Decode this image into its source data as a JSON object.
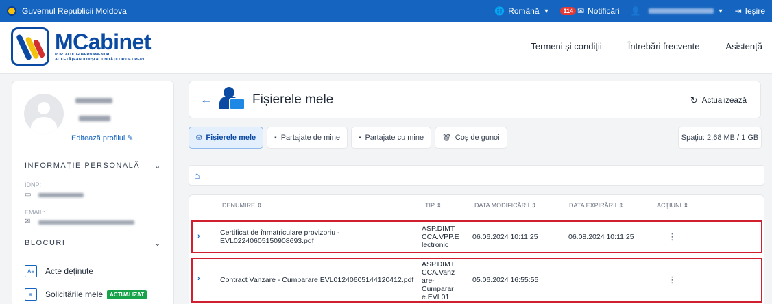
{
  "gov_bar": {
    "title": "Guvernul Republicii Moldova",
    "language": "Română",
    "notif_count": "114",
    "notifications": "Notificări",
    "logout": "Ieșire"
  },
  "header": {
    "logo_title": "MCabinet",
    "logo_sub1": "Portalul guvernamental",
    "logo_sub2": "al cetățeanului și al unităților de drept",
    "nav": [
      "Termeni și condiții",
      "Întrebări frecvente",
      "Asistență"
    ]
  },
  "sidebar": {
    "edit_profile": "Editează profilul",
    "personal_info": "INFORMAȚIE PERSONALĂ",
    "idnp_label": "IDNP:",
    "email_label": "EMAIL:",
    "blocks": "BLOCURI",
    "menu": [
      {
        "label": "Acte deținute"
      },
      {
        "label": "Solicitările mele",
        "badge": "ACTUALIZAT"
      }
    ]
  },
  "main": {
    "title": "Fișierele mele",
    "refresh": "Actualizează",
    "tabs": [
      "Fișierele mele",
      "Partajate de mine",
      "Partajate cu mine",
      "Coș de gunoi"
    ],
    "space": "Spațiu: 2.68 MB / 1 GB",
    "columns": [
      "DENUMIRE",
      "TIP",
      "DATA MODIFICĂRII",
      "DATA EXPIRĂRII",
      "ACȚIUNI"
    ],
    "rows": [
      {
        "name": "Certificat de înmatriculare provizoriu - EVL02240605150908693.pdf",
        "type": "ASP.DIMT CCA.VPP.E lectronic",
        "modified": "06.06.2024 10:11:25",
        "expires": "06.08.2024 10:11:25"
      },
      {
        "name": "Contract Vanzare - Cumparare EVL01240605144120412.pdf",
        "type": "ASP.DIMT CCA.Vanz are- Cumparar e.EVL01",
        "modified": "05.06.2024 16:55:55",
        "expires": ""
      }
    ]
  },
  "colors": {
    "accent": "#1565c0",
    "brand": "#0b4aa2",
    "highlight": "#d01f2e",
    "success": "#16a34a"
  }
}
